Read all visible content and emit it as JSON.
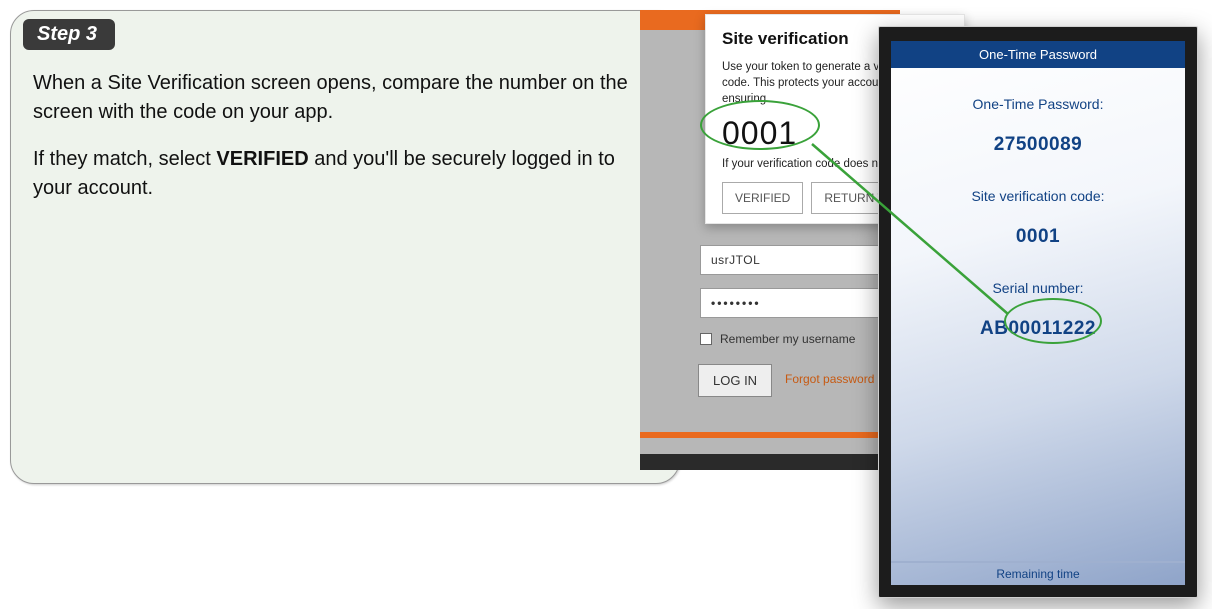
{
  "card": {
    "step_label": "Step 3",
    "p1_a": "When a Site Verification screen opens, compare the number on the screen with the code on your app.",
    "p2_a": "If they match, select ",
    "p2_bold": "VERIFIED",
    "p2_b": " and you'll be securely logged in to your account."
  },
  "bg": {
    "username_value": "usrJTOL",
    "password_mask": "••••••••",
    "remember_label": "Remember my username",
    "login_label": "LOG IN",
    "forgot_label": "Forgot password"
  },
  "site_ver": {
    "title": "Site verification",
    "desc": "Use your token to generate a verification code. This protects your account by ensuring",
    "code": "0001",
    "note": "If your verification code does n",
    "verified_label": "VERIFIED",
    "return_label": "RETURN TO"
  },
  "phone": {
    "title": "One-Time Password",
    "otp_label": "One-Time Password:",
    "otp_value": "27500089",
    "site_label": "Site verification code:",
    "site_value": "0001",
    "serial_label": "Serial number:",
    "serial_value": "AB00011222",
    "footer": "Remaining time"
  }
}
